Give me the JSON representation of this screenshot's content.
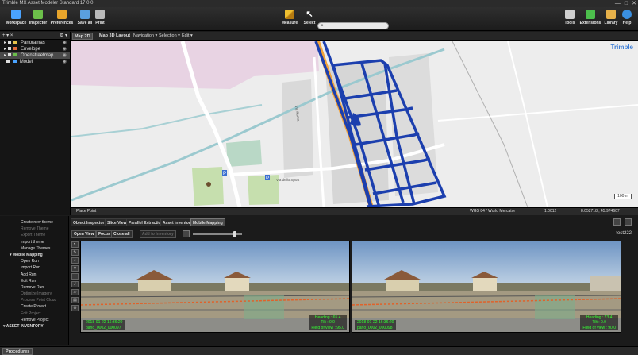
{
  "window": {
    "title": "Trimble MX Asset Modeler Standard 17.0.0",
    "controls": [
      "—",
      "□",
      "✕"
    ]
  },
  "ribbon": {
    "left": [
      {
        "label": "Workspace",
        "icon": "workspace-icon",
        "color": "#4aa3ff"
      },
      {
        "label": "Inspector",
        "icon": "inspector-icon",
        "color": "#6cc04a"
      },
      {
        "label": "Preferences",
        "icon": "preferences-icon",
        "color": "#e8a52b"
      },
      {
        "label": "Save all",
        "icon": "save-icon",
        "color": "#5aa0e0"
      },
      {
        "label": "Print",
        "icon": "print-icon",
        "color": "#bbbbbb"
      }
    ],
    "center": [
      {
        "label": "Measure",
        "icon": "measure-icon",
        "color": "#f0c030"
      },
      {
        "label": "Select",
        "icon": "select-icon",
        "color": "#ffffff"
      }
    ],
    "right": [
      {
        "label": "Tools",
        "icon": "tools-icon",
        "color": "#cfcfcf"
      },
      {
        "label": "Extensions",
        "icon": "extensions-icon",
        "color": "#4cbf4c"
      },
      {
        "label": "Library",
        "icon": "library-icon",
        "color": "#e6b14a"
      },
      {
        "label": "Help",
        "icon": "help-icon",
        "color": "#3a8fe0"
      }
    ]
  },
  "tree": {
    "toolbar_left": "+ ▾ ×",
    "toolbar_right": "⚙ ▾",
    "items": [
      {
        "label": "Panoramas",
        "color": "#e8c34a",
        "selected": false
      },
      {
        "label": "Envelope",
        "color": "#e36b3a",
        "selected": false
      },
      {
        "label": "Openstreetmap",
        "color": "#6bbf4b",
        "selected": true
      },
      {
        "label": "Model",
        "color": "#4aa3ff",
        "selected": false
      }
    ]
  },
  "map": {
    "tabs": [
      {
        "label": "Map 2D",
        "active": true
      },
      {
        "label": "Map 3D",
        "active": false
      },
      {
        "label": "Layout",
        "active": false
      }
    ],
    "menus": [
      "Navigation ▾",
      "Selection ▾",
      "Edit ▾"
    ],
    "brand": "Trimble",
    "street_labels": [
      "Via dello Sport",
      "Via Roma"
    ],
    "status": {
      "left": "Place Point",
      "crs": "WGS 84 / World Mercator",
      "scale": "1:0012",
      "coords": "8.052718 , 45.974607"
    },
    "scale_bar": "100 m"
  },
  "procedures": {
    "items": [
      {
        "label": "Create new theme",
        "type": "item",
        "enabled": true
      },
      {
        "label": "Remove Theme",
        "type": "item",
        "enabled": false
      },
      {
        "label": "Export Theme",
        "type": "item",
        "enabled": false
      },
      {
        "label": "Import theme",
        "type": "item",
        "enabled": true
      },
      {
        "label": "Manage Themes",
        "type": "item",
        "enabled": true
      },
      {
        "label": "▾ Mobile Mapping",
        "type": "head",
        "enabled": true
      },
      {
        "label": "Open Run",
        "type": "item",
        "enabled": true
      },
      {
        "label": "Import Run",
        "type": "item",
        "enabled": true
      },
      {
        "label": "Add Run",
        "type": "item",
        "enabled": true
      },
      {
        "label": "Edit Run",
        "type": "item",
        "enabled": true
      },
      {
        "label": "Remove Run",
        "type": "item",
        "enabled": true
      },
      {
        "label": "Optimize Imagery",
        "type": "item",
        "enabled": false
      },
      {
        "label": "Process Point Cloud",
        "type": "item",
        "enabled": false
      },
      {
        "label": "Create Project",
        "type": "item",
        "enabled": true
      },
      {
        "label": "Edit Project",
        "type": "item",
        "enabled": false
      },
      {
        "label": "Remove Project",
        "type": "item",
        "enabled": true
      },
      {
        "label": "▾ ASSET INVENTORY",
        "type": "head2",
        "enabled": true
      }
    ]
  },
  "viewer": {
    "tabs": [
      {
        "label": "Object Inspector",
        "active": false
      },
      {
        "label": "Slice View",
        "active": false
      },
      {
        "label": "Parallel Extraction",
        "active": false
      },
      {
        "label": "Asset Inventory",
        "active": false
      },
      {
        "label": "Mobile Mapping",
        "active": true
      }
    ],
    "buttons": [
      {
        "label": "Open View",
        "enabled": true
      },
      {
        "label": "Focus",
        "enabled": true
      },
      {
        "label": "Close all",
        "enabled": true
      },
      {
        "label": "Add to Inventory",
        "enabled": false
      }
    ],
    "run_name": "test222",
    "slider_value": 0.85,
    "left_image": {
      "heading": "Heading : 65.4",
      "tilt": "Tilt : 0.0",
      "fov": "Field of view : 95.0",
      "time": "2018-01-22 16:36:20",
      "name": "pano_0002_000097"
    },
    "right_image": {
      "heading": "Heading : 73.4",
      "tilt": "Tilt : 0.0",
      "fov": "Field of view : 90.0",
      "time": "2018-01-22 16:36:20",
      "name": "pano_0002_000098"
    }
  },
  "bottom_tab": "Procedures"
}
